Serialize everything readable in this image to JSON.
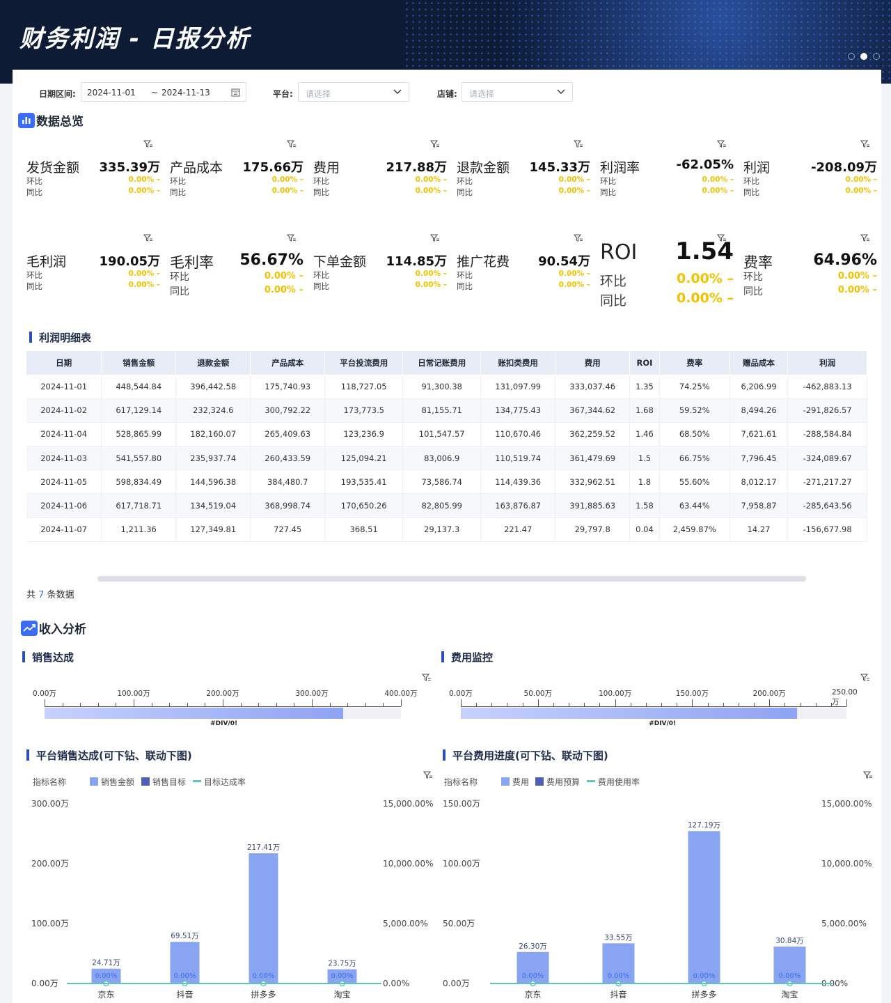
{
  "header": {
    "title": "财务利润 - 日报分析"
  },
  "filters": {
    "date_label": "日期区间:",
    "date_start": "2024-11-01",
    "date_sep": "~",
    "date_end": "2024-11-13",
    "platform_label": "平台:",
    "platform_placeholder": "请选择",
    "shop_label": "店铺:",
    "shop_placeholder": "请选择"
  },
  "overview": {
    "title": "数据总览",
    "mom_label": "环比",
    "yoy_label": "同比",
    "pct": "0.00% –",
    "kpis": [
      {
        "name": "发货金额",
        "value": "335.39万"
      },
      {
        "name": "产品成本",
        "value": "175.66万"
      },
      {
        "name": "费用",
        "value": "217.88万"
      },
      {
        "name": "退款金额",
        "value": "145.33万"
      },
      {
        "name": "利润率",
        "value": "-62.05%"
      },
      {
        "name": "利润",
        "value": "-208.09万"
      },
      {
        "name": "毛利润",
        "value": "190.05万"
      },
      {
        "name": "毛利率",
        "value": "56.67%"
      },
      {
        "name": "下单金额",
        "value": "114.85万"
      },
      {
        "name": "推广花费",
        "value": "90.54万"
      },
      {
        "name": "ROI",
        "value": "1.54"
      },
      {
        "name": "费率",
        "value": "64.96%"
      }
    ]
  },
  "profit_table": {
    "title": "利润明细表",
    "columns": [
      "日期",
      "销售金额",
      "退款金额",
      "产品成本",
      "平台投流费用",
      "日常记账费用",
      "账扣类费用",
      "费用",
      "ROI",
      "费率",
      "赠品成本",
      "利润"
    ],
    "rows": [
      [
        "2024-11-01",
        "448,544.84",
        "396,442.58",
        "175,740.93",
        "118,727.05",
        "91,300.38",
        "131,097.99",
        "333,037.46",
        "1.35",
        "74.25%",
        "6,206.99",
        "-462,883.13"
      ],
      [
        "2024-11-02",
        "617,129.14",
        "232,324.6",
        "300,792.22",
        "173,773.5",
        "81,155.71",
        "134,775.43",
        "367,344.62",
        "1.68",
        "59.52%",
        "8,494.26",
        "-291,826.57"
      ],
      [
        "2024-11-04",
        "528,865.99",
        "182,160.07",
        "265,409.63",
        "123,236.9",
        "101,547.57",
        "110,670.46",
        "362,259.52",
        "1.46",
        "68.50%",
        "7,621.61",
        "-288,584.84"
      ],
      [
        "2024-11-03",
        "541,557.80",
        "235,937.74",
        "260,433.59",
        "125,094.21",
        "83,006.9",
        "110,519.74",
        "361,479.69",
        "1.5",
        "66.75%",
        "7,796.45",
        "-324,089.67"
      ],
      [
        "2024-11-05",
        "598,834.49",
        "144,596.38",
        "384,480.7",
        "193,535.41",
        "73,586.74",
        "114,439.36",
        "332,962.51",
        "1.8",
        "55.60%",
        "8,012.17",
        "-271,217.27"
      ],
      [
        "2024-11-06",
        "617,718.71",
        "134,519.04",
        "368,998.74",
        "170,650.26",
        "82,805.99",
        "163,876.87",
        "391,885.63",
        "1.58",
        "63.44%",
        "7,958.87",
        "-285,643.56"
      ],
      [
        "2024-11-07",
        "1,211.36",
        "127,349.81",
        "727.45",
        "368.51",
        "29,137.3",
        "221.47",
        "29,797.8",
        "0.04",
        "2,459.87%",
        "14.27",
        "-156,677.98"
      ]
    ],
    "count_prefix": "共",
    "count": "7",
    "count_suffix": "条数据"
  },
  "income": {
    "title": "收入分析"
  },
  "sales_gauge": {
    "title": "销售达成",
    "ticks": [
      "0.00万",
      "100.00万",
      "200.00万",
      "300.00万",
      "400.00万"
    ],
    "max": 400,
    "value": 335.39,
    "label": "#DIV/0!"
  },
  "cost_gauge": {
    "title": "费用监控",
    "ticks": [
      "0.00万",
      "50.00万",
      "100.00万",
      "150.00万",
      "200.00万",
      "250.00万"
    ],
    "max": 250,
    "value": 217.88,
    "label": "#DIV/0!"
  },
  "chart_data": [
    {
      "type": "bar",
      "title": "平台销售达成(可下钻、联动下图)",
      "legend_title": "指标名称",
      "categories": [
        "京东",
        "抖音",
        "拼多多",
        "淘宝"
      ],
      "series": [
        {
          "name": "销售金额",
          "values": [
            24.71,
            69.51,
            217.41,
            23.75
          ],
          "labels": [
            "24.71万",
            "69.51万",
            "217.41万",
            "23.75万"
          ],
          "color": "#89a5f2"
        },
        {
          "name": "销售目标",
          "values": [
            0,
            0,
            0,
            0
          ],
          "color": "#4e5fb5"
        },
        {
          "name": "目标达成率",
          "values": [
            0,
            0,
            0,
            0
          ],
          "labels": [
            "0.00%",
            "0.00%",
            "0.00%",
            "0.00%"
          ],
          "color": "#62c4b8"
        }
      ],
      "y_ticks": [
        "0.00万",
        "100.00万",
        "200.00万",
        "300.00万"
      ],
      "ylim": [
        0,
        300
      ],
      "y2_ticks": [
        "0.00%",
        "5,000.00%",
        "10,000.00%",
        "15,000.00%"
      ]
    },
    {
      "type": "bar",
      "title": "平台费用进度(可下钻、联动下图)",
      "legend_title": "指标名称",
      "categories": [
        "京东",
        "抖音",
        "拼多多",
        "淘宝"
      ],
      "series": [
        {
          "name": "费用",
          "values": [
            26.3,
            33.55,
            127.19,
            30.84
          ],
          "labels": [
            "26.30万",
            "33.55万",
            "127.19万",
            "30.84万"
          ],
          "color": "#89a5f2"
        },
        {
          "name": "费用预算",
          "values": [
            0,
            0,
            0,
            0
          ],
          "color": "#4e5fb5"
        },
        {
          "name": "费用使用率",
          "values": [
            0,
            0,
            0,
            0
          ],
          "labels": [
            "0.00%",
            "0.00%",
            "0.00%",
            "0.00%"
          ],
          "color": "#62c4b8"
        }
      ],
      "y_ticks": [
        "0.00万",
        "50.00万",
        "100.00万",
        "150.00万"
      ],
      "ylim": [
        0,
        150
      ],
      "y2_ticks": [
        "0.00%",
        "5,000.00%",
        "10,000.00%",
        "15,000.00%"
      ]
    }
  ]
}
